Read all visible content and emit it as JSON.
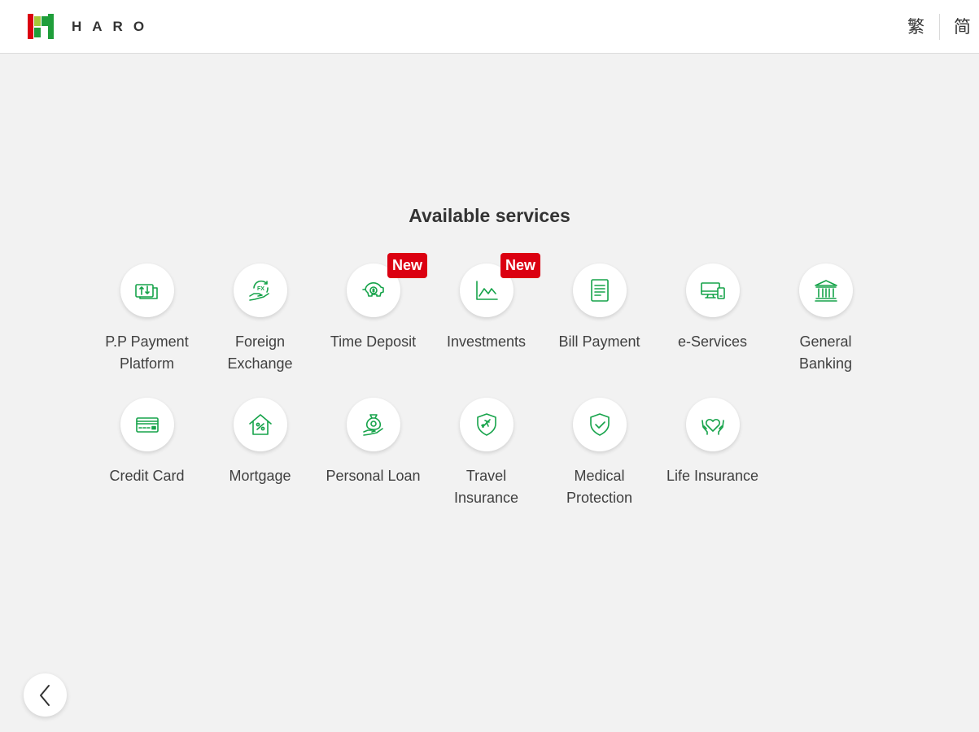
{
  "header": {
    "brand": "HARO",
    "lang_traditional": "繁",
    "lang_simplified": "简"
  },
  "main": {
    "title": "Available services",
    "badge_new": "New",
    "services": [
      {
        "label": "P.P Payment\nPlatform",
        "icon": "payment-transfer-icon"
      },
      {
        "label": "Foreign\nExchange",
        "icon": "fx-exchange-icon"
      },
      {
        "label": "Time Deposit",
        "icon": "piggy-bank-icon",
        "badge": "New"
      },
      {
        "label": "Investments",
        "icon": "line-chart-icon",
        "badge": "New"
      },
      {
        "label": "Bill Payment",
        "icon": "bill-document-icon"
      },
      {
        "label": "e-Services",
        "icon": "devices-icon"
      },
      {
        "label": "General\nBanking",
        "icon": "bank-building-icon"
      },
      {
        "label": "Credit Card",
        "icon": "credit-card-icon"
      },
      {
        "label": "Mortgage",
        "icon": "house-percent-icon"
      },
      {
        "label": "Personal Loan",
        "icon": "money-bag-hand-icon"
      },
      {
        "label": "Travel\nInsurance",
        "icon": "shield-plane-icon"
      },
      {
        "label": "Medical\nProtection",
        "icon": "shield-check-icon"
      },
      {
        "label": "Life Insurance",
        "icon": "heart-hands-icon"
      }
    ]
  },
  "colors": {
    "accent_green": "#16a34a",
    "badge_red": "#db0011",
    "logo_red": "#db0011",
    "logo_green": "#1f9e3a",
    "logo_lime": "#a4c639"
  },
  "footer": {
    "back_icon": "chevron-left-icon"
  }
}
